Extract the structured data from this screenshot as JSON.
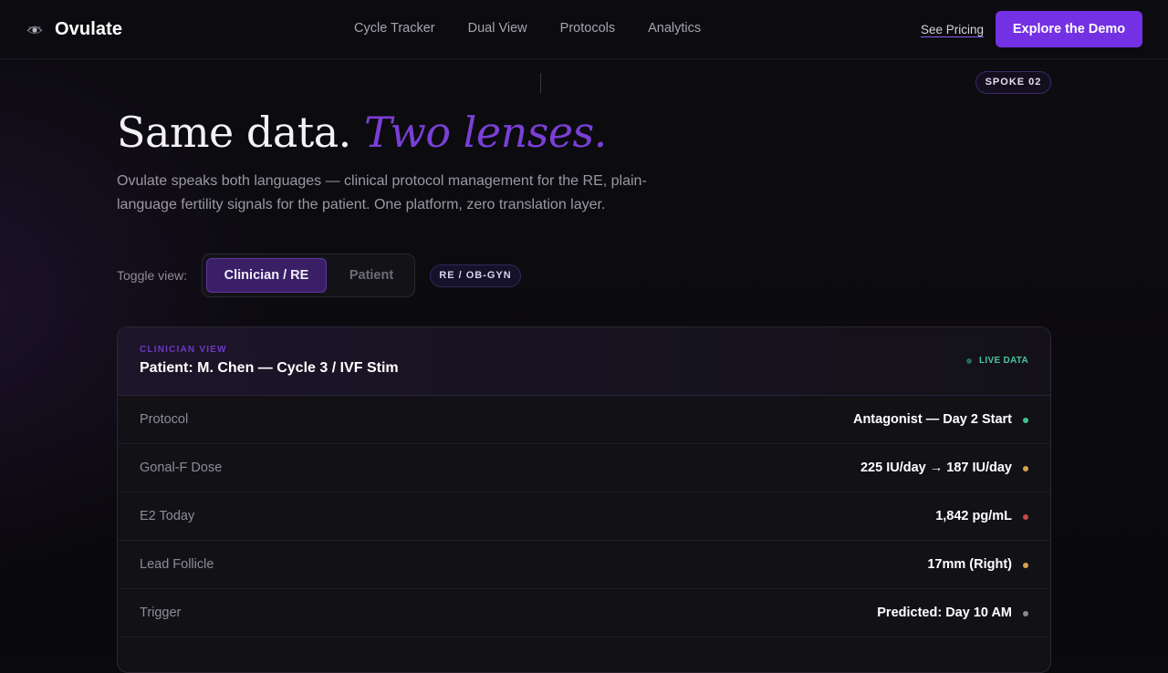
{
  "brand": {
    "name": "Ovulate",
    "icon": "eye-icon"
  },
  "nav": {
    "links": [
      "Cycle Tracker",
      "Dual View",
      "Protocols",
      "Analytics"
    ],
    "see_pricing": "See Pricing",
    "demo_button": "Explore the Demo"
  },
  "spoke_badge": "SPOKE 02",
  "hero": {
    "title_plain": "Same data.",
    "title_accent": "Two lenses.",
    "subtitle": "Ovulate speaks both languages — clinical protocol management for the RE, plain-language fertility signals for the patient. One platform, zero translation layer."
  },
  "toggle": {
    "label": "Toggle view:",
    "options": [
      "Clinician / RE",
      "Patient"
    ],
    "selected": "Clinician / RE",
    "role_badge": "RE / OB-GYN"
  },
  "panel": {
    "kicker": "CLINICIAN VIEW",
    "title": "Patient: M. Chen — Cycle 3 / IVF Stim",
    "live_label": "LIVE DATA",
    "rows": [
      {
        "label": "Protocol",
        "value": "Antagonist — Day 2 Start",
        "status_color": "#3fc48f"
      },
      {
        "label": "Gonal-F Dose",
        "value": "225 IU/day → 187 IU/day",
        "status_color": "#d4a447"
      },
      {
        "label": "E2 Today",
        "value": "1,842 pg/mL",
        "status_color": "#c9484a"
      },
      {
        "label": "Lead Follicle",
        "value": "17mm (Right)",
        "status_color": "#d4a447"
      },
      {
        "label": "Trigger",
        "value": "Predicted: Day 10 AM",
        "status_color": "#8b8894"
      }
    ]
  },
  "colors": {
    "accent": "#7431e4",
    "live": "#48c29a"
  }
}
